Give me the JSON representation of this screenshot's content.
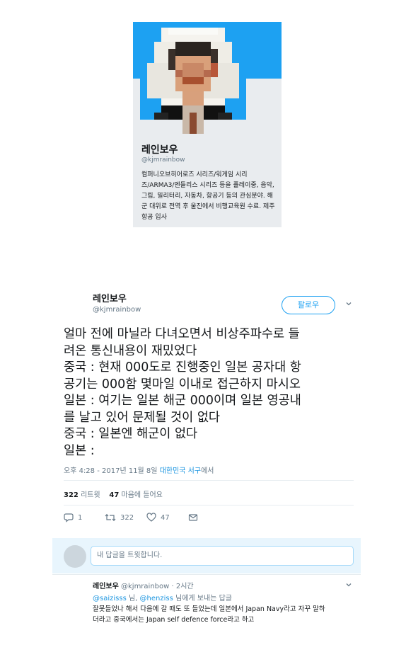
{
  "profile_card": {
    "name": "레인보우",
    "handle": "@kjmrainbow",
    "bio": "컴퍼니오브히어로즈 시리즈/워게임 시리즈/ARMA3/엔들리스 시리즈 등을 플레이중, 음악, 그림, 밀리터리, 자동차, 항공기 등의 관심분야. 해군 대위로 전역 후 울진에서 비행교육원 수료. 제주항공 입사",
    "colors": {
      "banner": "#1da1f2",
      "card_bg": "#e9ecef"
    }
  },
  "tweet": {
    "name": "레인보우",
    "handle": "@kjmrainbow",
    "follow_label": "팔로우",
    "text_lines": [
      "얼마 전에 마닐라 다녀오면서 비상주파수로 들",
      "려온 통신내용이 재밌었다",
      "중국 : 현재 000도로 진행중인 일본 공자대 항",
      "공기는 000함 몇마일 이내로 접근하지 마시오",
      "일본 : 여기는 일본 해군 000이며 일본 영공내",
      "를 날고 있어 문제될 것이 없다",
      "중국 : 일본엔 해군이 없다",
      "일본 :"
    ],
    "timestamp": "오후 4:28 - 2017년 11월 8일",
    "location": "대한민국 서구",
    "location_suffix": "에서",
    "retweets_count": "322",
    "retweets_label": "리트윗",
    "likes_count": "47",
    "likes_label": "마음에 들어요",
    "actions": {
      "reply_count": "1",
      "retweet_count": "322",
      "like_count": "47"
    },
    "colors": {
      "accent": "#1da1f2",
      "muted": "#657786"
    }
  },
  "reply_box": {
    "placeholder": "내 답글을 트윗합니다."
  },
  "reply": {
    "name": "레인보우",
    "handle": "@kjmrainbow",
    "time": "· 2시간",
    "mention1": "@saizisss",
    "mid": "님,",
    "mention2": "@henziss",
    "suffix": "님에게 보내는 답글",
    "text_lines": [
      "잘못들었나 해서 다음에 갈 때도 또 들었는데 일본에서 Japan Navy라고 자꾸 말하",
      "더라고 중국에서는 Japan self defence force라고 하고"
    ]
  }
}
